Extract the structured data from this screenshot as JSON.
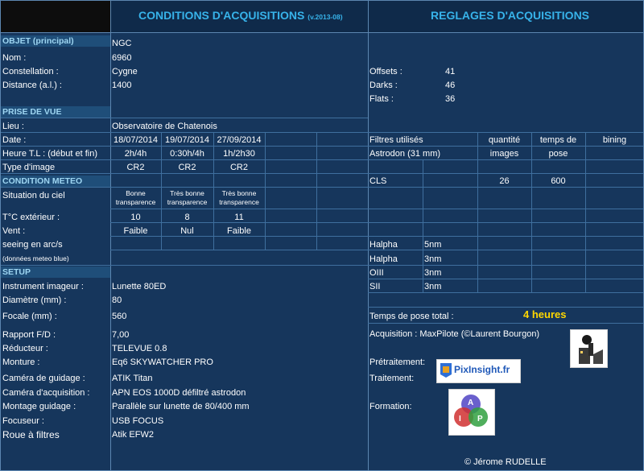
{
  "header": {
    "title_left": "CONDITIONS D'ACQUISITIONS",
    "version": "(v.2013-08)",
    "title_right": "REGLAGES D'ACQUISITIONS"
  },
  "objet": {
    "section": "OBJET (principal)",
    "catalog_value": "NGC",
    "nom_label": "Nom :",
    "nom_value": "6960",
    "constellation_label": "Constellation :",
    "constellation_value": "Cygne",
    "distance_label": "Distance (a.l.) :",
    "distance_value": "1400"
  },
  "prise": {
    "section": "PRISE DE VUE",
    "lieu_label": "Lieu :",
    "lieu_value": "Observatoire de Chatenois",
    "date_label": "Date :",
    "dates": [
      "18/07/2014",
      "19/07/2014",
      "27/09/2014"
    ],
    "heure_label": "Heure T.L : (début et fin)",
    "heures": [
      "2h/4h",
      "0:30h/4h",
      "1h/2h30"
    ],
    "type_label": "Type d'image",
    "types": [
      "CR2",
      "CR2",
      "CR2"
    ]
  },
  "meteo": {
    "section": "CONDITION METEO",
    "ciel_label": "Situation du ciel",
    "ciel": [
      [
        "Bonne",
        "transparence"
      ],
      [
        "Très bonne",
        "transparence"
      ],
      [
        "Très bonne",
        "transparence"
      ]
    ],
    "temp_label": "T°C extérieur :",
    "temps": [
      "10",
      "8",
      "11"
    ],
    "vent_label": "Vent :",
    "vents": [
      "Faible",
      "Nul",
      "Faible"
    ],
    "seeing_label": "seeing en arc/s",
    "source_note": "(données meteo blue)"
  },
  "setup": {
    "section": "SETUP",
    "rows": [
      {
        "label": "Instrument imageur :",
        "value": "Lunette 80ED"
      },
      {
        "label": "Diamètre (mm) :",
        "value": "80"
      },
      {
        "label": "Focale (mm) :",
        "value": "560"
      },
      {
        "label": "Rapport F/D :",
        "value": "7,00"
      },
      {
        "label": "Réducteur :",
        "value": "TELEVUE 0.8"
      },
      {
        "label": "Monture :",
        "value": "Eq6 SKYWATCHER PRO"
      },
      {
        "label": "Caméra de guidage :",
        "value": "ATIK Titan"
      },
      {
        "label": "Caméra d'acquisition :",
        "value": "APN EOS 1000D défiltré astrodon"
      },
      {
        "label": "Montage guidage :",
        "value": "Parallèle sur lunette de 80/400 mm"
      },
      {
        "label": "Focuseur :",
        "value": "USB FOCUS"
      },
      {
        "label": "Roue à filtres",
        "value": "Atik EFW2"
      }
    ]
  },
  "reglages": {
    "offsets_label": "Offsets :",
    "offsets_value": "41",
    "darks_label": "Darks :",
    "darks_value": "46",
    "flats_label": "Flats :",
    "flats_value": "36",
    "filtres_header": "Filtres utilisés",
    "quantite_header": "quantité",
    "images_header": "images",
    "temps_header_1": "temps de",
    "temps_header_2": "pose",
    "bining_header": "bining",
    "filter_set": "Astrodon (31 mm)",
    "cls": {
      "name": "CLS",
      "quantity": "26",
      "pose": "600"
    },
    "narrowband": [
      {
        "name": "Halpha",
        "band": "5nm"
      },
      {
        "name": "Halpha",
        "band": "3nm"
      },
      {
        "name": "OIII",
        "band": "3nm"
      },
      {
        "name": "SII",
        "band": "3nm"
      }
    ],
    "total_label": "Temps de pose total :",
    "total_value": "4 heures",
    "acquisition": "Acquisition : MaxPilote (©Laurent Bourgon)",
    "pretraitement": "Prétraitement:",
    "traitement": "Traitement:",
    "formation": "Formation:",
    "pixinsight_logo": "PixInsight.fr",
    "api_letters": [
      "A",
      "I",
      "P"
    ],
    "credit": "© Jérome RUDELLE"
  }
}
